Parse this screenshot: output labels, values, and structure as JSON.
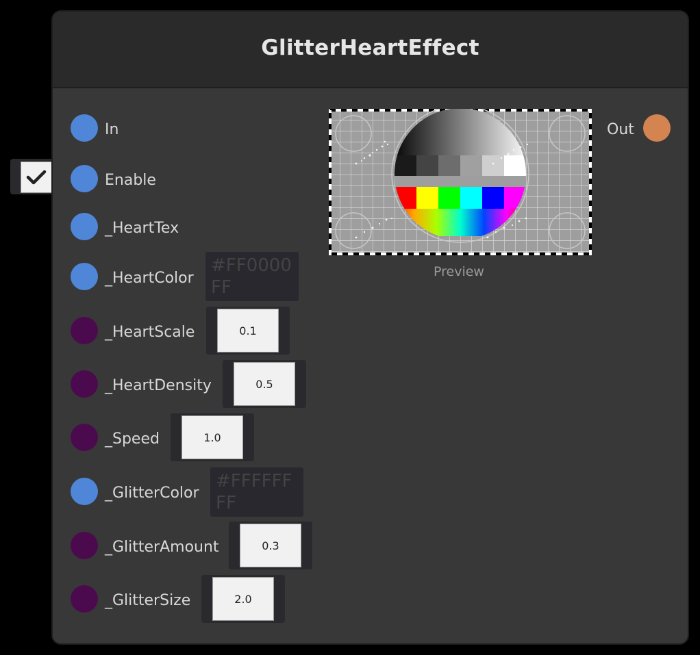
{
  "node": {
    "title": "GlitterHeartEffect",
    "preview_label": "Preview"
  },
  "colors": {
    "port_vector": "#4f86d8",
    "port_float": "#4c0a4e",
    "port_out": "#d48450",
    "node_bg": "#383838",
    "header_bg": "#2a2a2a"
  },
  "ports": {
    "in": {
      "label": "In",
      "type": "flow"
    },
    "enable": {
      "label": "Enable",
      "type": "bool",
      "checked": true
    },
    "heart_tex": {
      "label": "_HeartTex",
      "type": "texture"
    },
    "heart_color": {
      "label": "_HeartColor",
      "type": "color",
      "value": "#FF0000FF"
    },
    "heart_scale": {
      "label": "_HeartScale",
      "type": "float",
      "value": "0.1"
    },
    "heart_density": {
      "label": "_HeartDensity",
      "type": "float",
      "value": "0.5"
    },
    "speed": {
      "label": "_Speed",
      "type": "float",
      "value": "1.0"
    },
    "glitter_color": {
      "label": "_GlitterColor",
      "type": "color",
      "value": "#FFFFFFFF"
    },
    "glitter_amount": {
      "label": "_GlitterAmount",
      "type": "float",
      "value": "0.3"
    },
    "glitter_size": {
      "label": "_GlitterSize",
      "type": "float",
      "value": "2.0"
    },
    "out": {
      "label": "Out",
      "type": "flow"
    }
  },
  "icons": {
    "enable_check": "checkmark-icon"
  }
}
